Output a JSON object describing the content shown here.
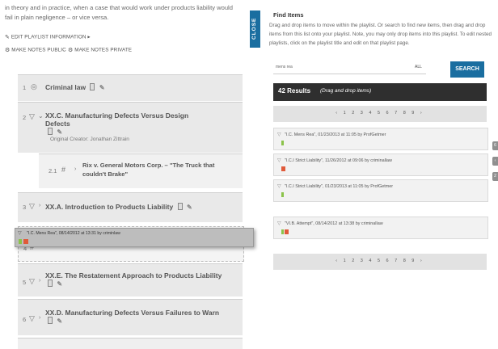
{
  "left": {
    "intro": "in theory and in practice, when a case that would work under products liability would fail in plain negligence – or vice versa.",
    "edit_playlist": "EDIT PLAYLIST INFORMATION ▸",
    "make_public": "MAKE NOTES PUBLIC",
    "make_private": "MAKE NOTES PRIVATE",
    "rows": [
      {
        "num": "1",
        "title": "Criminal law"
      },
      {
        "num": "2",
        "title": "XX.C. Manufacturing Defects Versus Design Defects",
        "creator": "Original Creator: Jonathan Zittrain"
      },
      {
        "num": "2.1",
        "title": "Rix v. General Motors Corp. – \"The Truck that couldn't Brake\""
      },
      {
        "num": "3",
        "title": "XX.A. Introduction to Products Liability"
      },
      {
        "num": "4",
        "title": ""
      },
      {
        "num": "5",
        "title": "XX.E. The Restatement Approach to Products Liability"
      },
      {
        "num": "6",
        "title": "XX.D. Manufacturing Defects Versus Failures to Warn"
      }
    ],
    "dragging_item": "\"I.C. Mens Rea\", 08/14/2012 at 13:31 by criminlaw"
  },
  "close_tab": "CLOSE",
  "right": {
    "title": "Find Items",
    "desc": "Drag and drop items to move within the playlist. Or search to find new items, then drag and drop items from this list onto your playlist. Note, you may only drop items into this playlist. To edit nested playlists, click on the playlist title and edit on that playlist page.",
    "search_value": "mens rea",
    "filter_value": "ALL",
    "search_button": "SEARCH",
    "results_count": "42 Results",
    "results_hint": "(Drag and drop items)",
    "pager": "‹ 1 2 3 4 5 6 7 8 9 ›",
    "items": [
      {
        "text": "\"I.C. Mens Rea\", 01/23/2013 at 11:05 by ProfGetmer"
      },
      {
        "text": "\"I.C.I Strict Liability\", 11/26/2012 at 09:06 by criminallaw"
      },
      {
        "text": "\"I.C.I Strict Liability\", 01/23/2013 at 11:05 by ProfGetmer"
      },
      {
        "text": "\"VI.B. Attempt\", 08/14/2012 at 13:38 by criminallaw"
      }
    ]
  },
  "edge_tabs": [
    "6",
    "‹",
    "2"
  ],
  "colors": {
    "accent": "#1a6ea0",
    "dark_bar": "#2f2f2f",
    "red": "#e05a3a",
    "green": "#8bc34a"
  }
}
